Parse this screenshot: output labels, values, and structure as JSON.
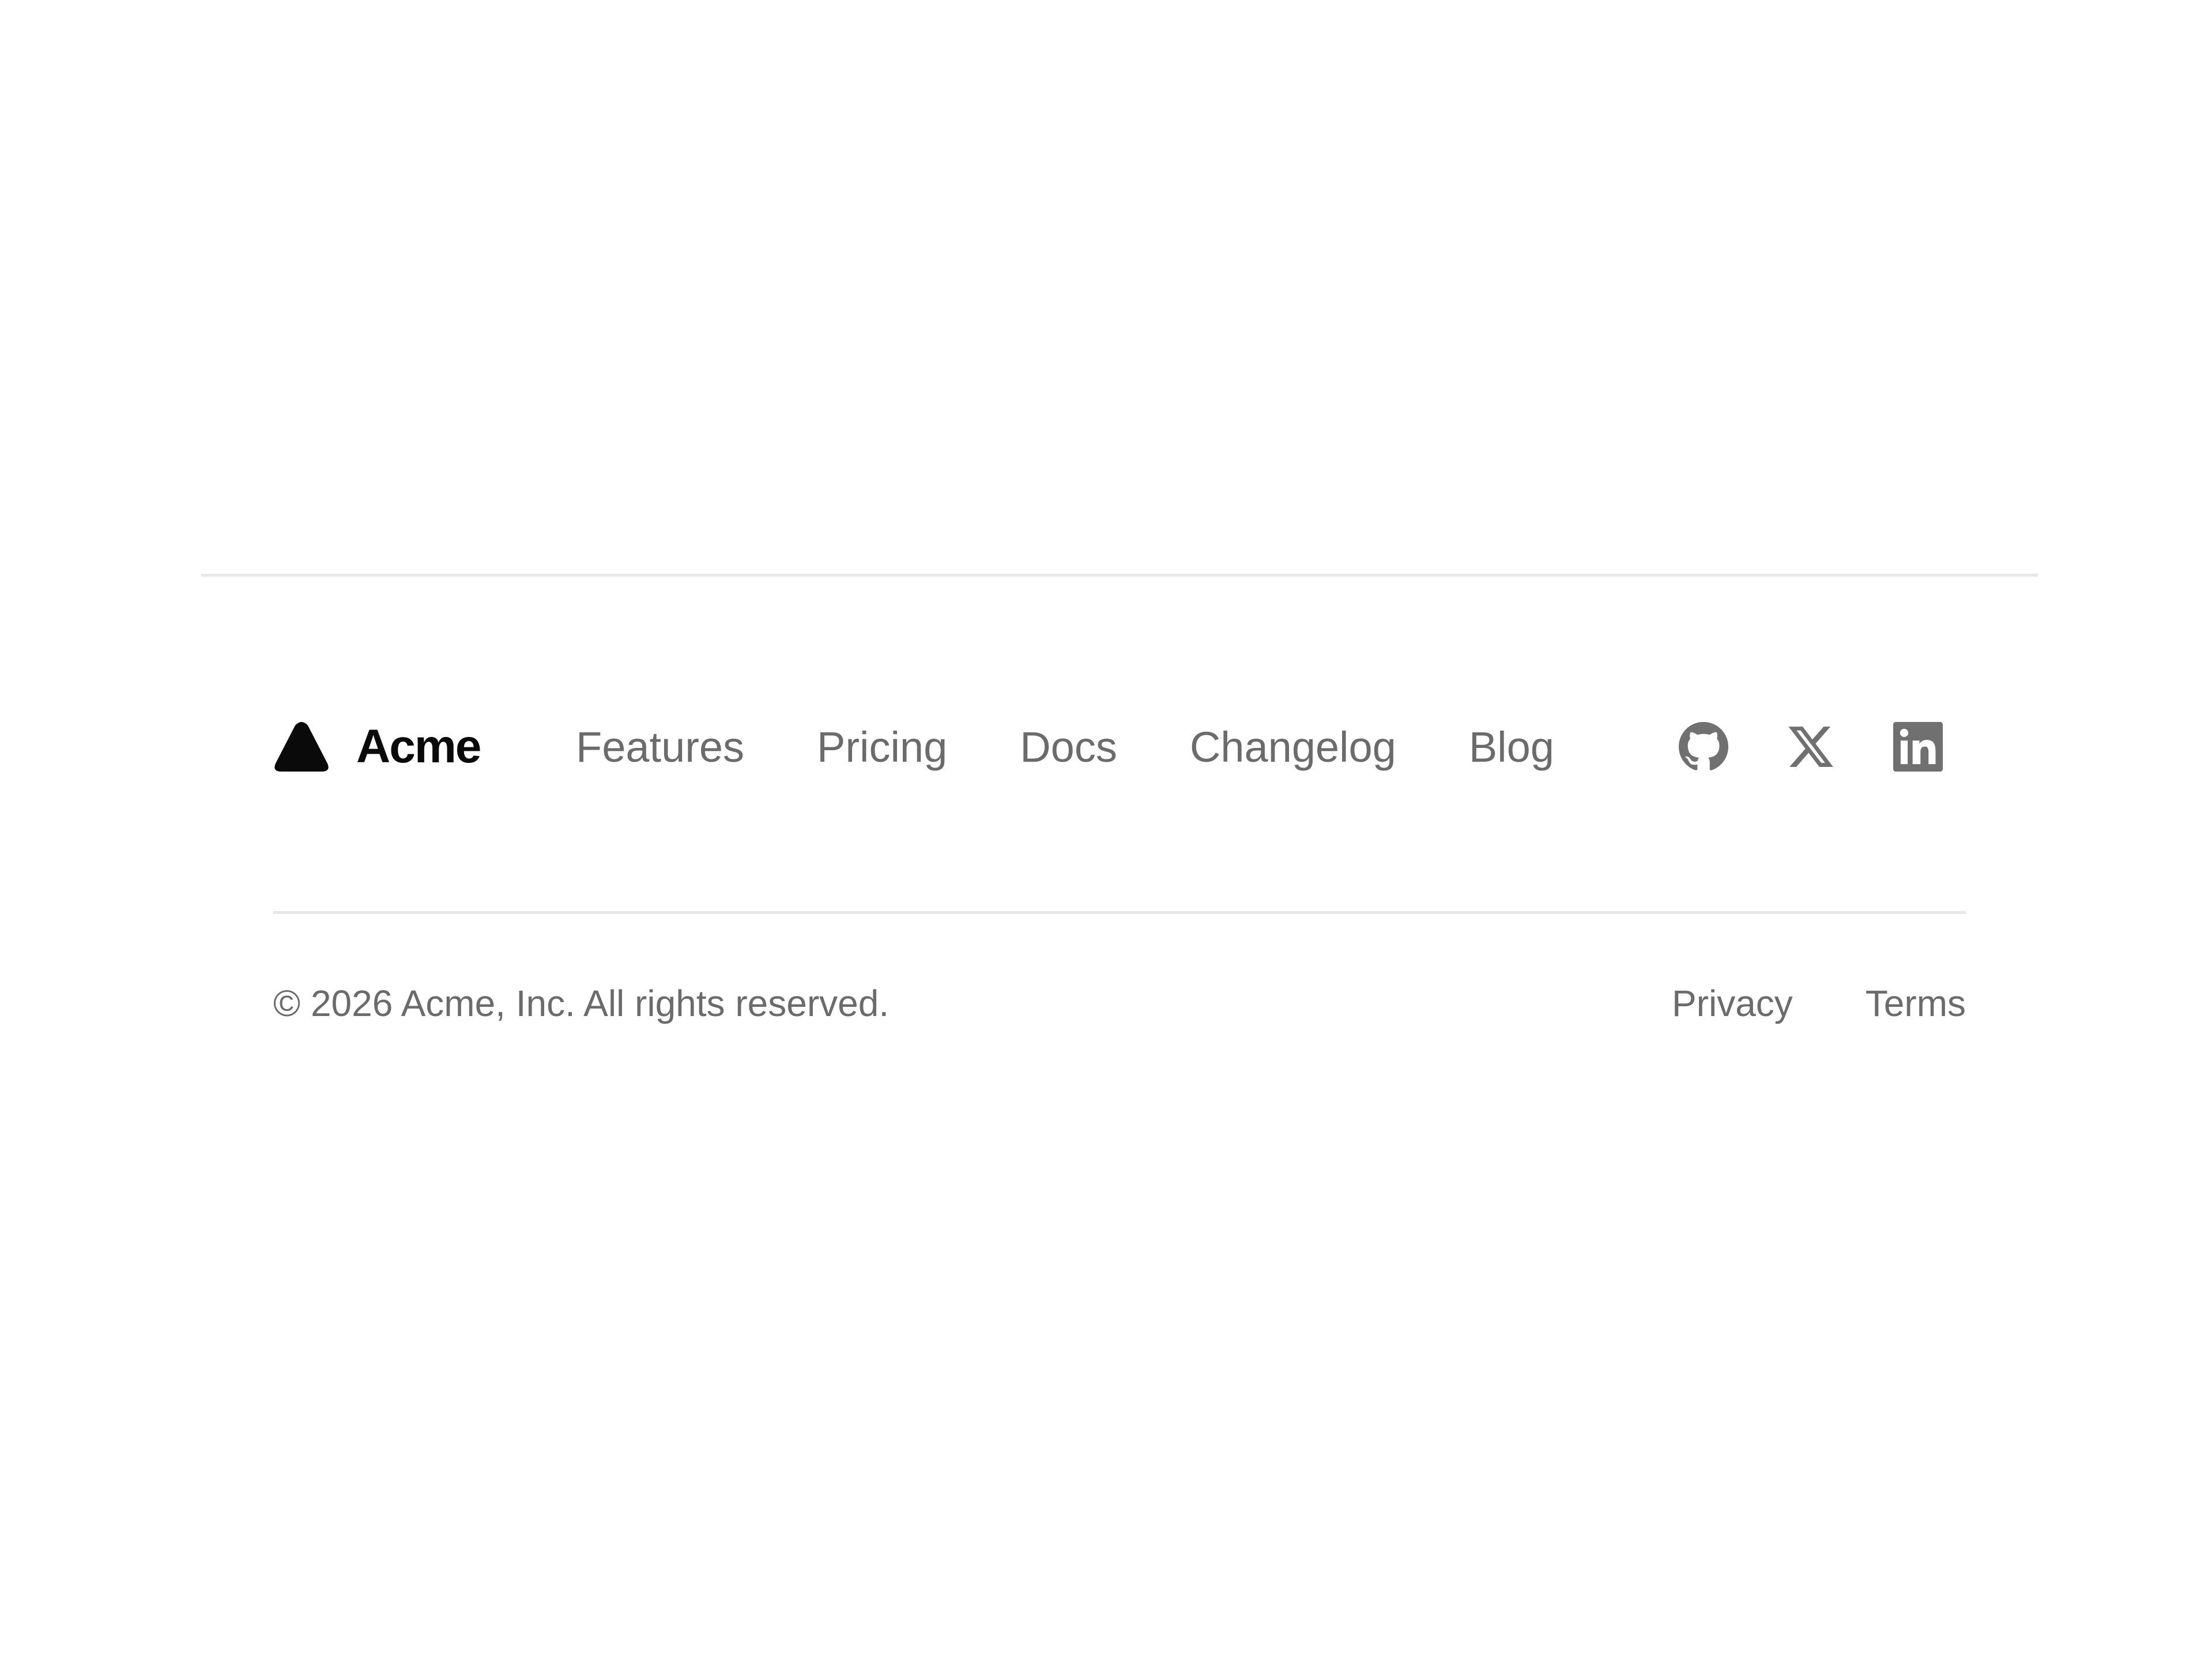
{
  "brand": {
    "name": "Acme",
    "logo_icon": "triangle-logo-icon",
    "color": "#0a0a0a"
  },
  "nav": {
    "links": [
      {
        "label": "Features"
      },
      {
        "label": "Pricing"
      },
      {
        "label": "Docs"
      },
      {
        "label": "Changelog"
      },
      {
        "label": "Blog"
      }
    ]
  },
  "social": {
    "icons": [
      "github-icon",
      "x-icon",
      "linkedin-icon"
    ],
    "color": "#707070"
  },
  "footer": {
    "copyright": "© 2026 Acme, Inc. All rights reserved.",
    "legal": [
      {
        "label": "Privacy"
      },
      {
        "label": "Terms"
      }
    ]
  },
  "colors": {
    "text_muted": "#6b6b6b",
    "divider": "#e6e6e6",
    "background": "#ffffff"
  }
}
